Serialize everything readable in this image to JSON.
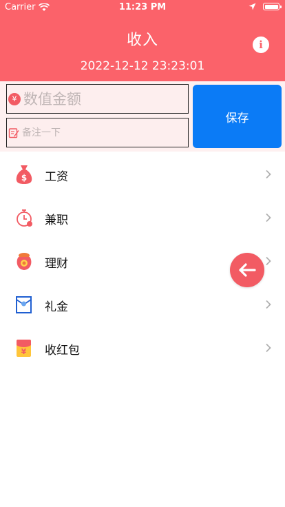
{
  "status_bar": {
    "carrier": "Carrier",
    "time": "11:23 PM"
  },
  "header": {
    "title": "收入",
    "datetime": "2022-12-12 23:23:01",
    "info_icon": "info-icon"
  },
  "form": {
    "amount": {
      "value": "",
      "placeholder": "数值金额",
      "icon": "yen-icon"
    },
    "note": {
      "value": "",
      "placeholder": "备注一下",
      "icon": "edit-note-icon"
    },
    "save_label": "保存"
  },
  "categories": [
    {
      "label": "工资",
      "icon": "money-bag-icon"
    },
    {
      "label": "兼职",
      "icon": "clock-icon"
    },
    {
      "label": "理财",
      "icon": "investment-bag-icon"
    },
    {
      "label": "礼金",
      "icon": "gift-envelope-icon"
    },
    {
      "label": "收红包",
      "icon": "red-envelope-icon"
    }
  ],
  "colors": {
    "header_bg": "#fb626a",
    "save_button": "#0b7bf6",
    "form_bg": "#fef0f0",
    "accent_red": "#f25b63"
  },
  "fab": {
    "icon": "back-arrow-icon"
  }
}
